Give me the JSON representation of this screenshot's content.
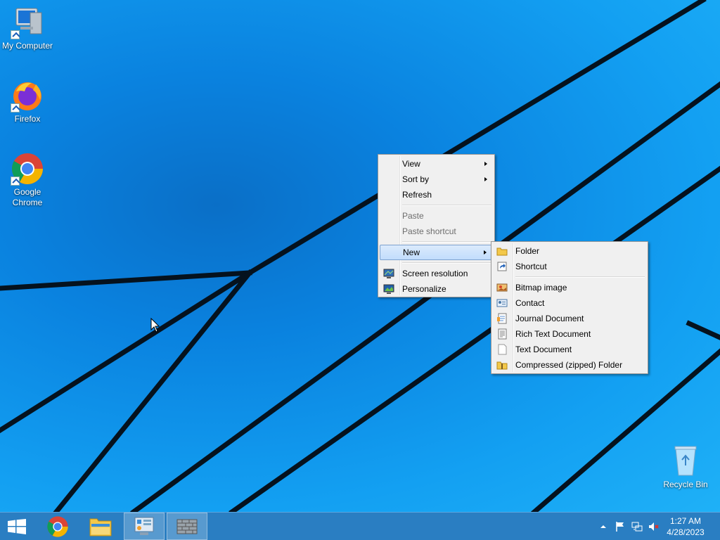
{
  "desktop": {
    "icons": [
      {
        "label": "My Computer"
      },
      {
        "label": "Firefox"
      },
      {
        "label": "Google Chrome"
      },
      {
        "label": "Recycle Bin"
      }
    ]
  },
  "context_menu": {
    "items": [
      {
        "label": "View",
        "submenu": true
      },
      {
        "label": "Sort by",
        "submenu": true
      },
      {
        "label": "Refresh"
      },
      {
        "label": "Paste",
        "disabled": true
      },
      {
        "label": "Paste shortcut",
        "disabled": true
      },
      {
        "label": "New",
        "submenu": true,
        "selected": true
      },
      {
        "label": "Screen resolution",
        "icon": "screen-resolution-icon"
      },
      {
        "label": "Personalize",
        "icon": "personalize-icon"
      }
    ]
  },
  "new_submenu": {
    "items": [
      {
        "label": "Folder",
        "icon": "folder-icon"
      },
      {
        "label": "Shortcut",
        "icon": "shortcut-icon"
      },
      {
        "label": "Bitmap image",
        "icon": "bitmap-icon"
      },
      {
        "label": "Contact",
        "icon": "contact-icon"
      },
      {
        "label": "Journal Document",
        "icon": "journal-icon"
      },
      {
        "label": "Rich Text Document",
        "icon": "rich-text-icon"
      },
      {
        "label": "Text Document",
        "icon": "text-document-icon"
      },
      {
        "label": "Compressed (zipped) Folder",
        "icon": "zip-folder-icon"
      }
    ]
  },
  "taskbar": {
    "clock_time": "1:27 AM",
    "clock_date": "4/28/2023"
  },
  "colors": {
    "wallpaper": "#0b8be6",
    "taskbar": "#2a7ec2",
    "menu_bg": "#f0f0f0",
    "menu_highlight": "#c1dcfc"
  }
}
